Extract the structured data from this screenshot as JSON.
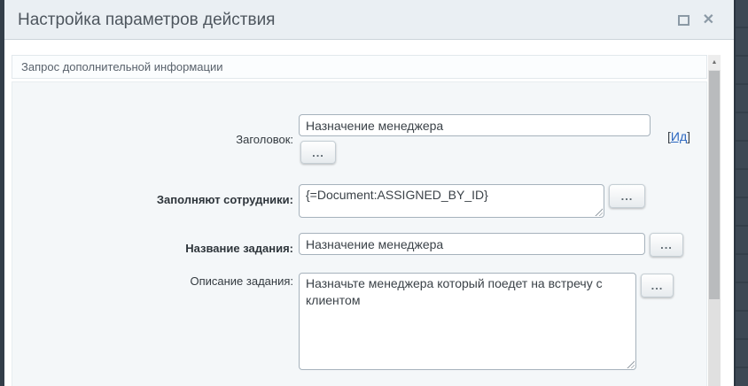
{
  "window": {
    "title": "Настройка параметров действия",
    "close_glyph": "✕"
  },
  "section": {
    "header": "Запрос дополнительной информации"
  },
  "form": {
    "header_field": {
      "label": "Заголовок:",
      "value": "Назначение менеджера",
      "button": "...",
      "id_link_open": "[",
      "id_link_text": "Ид",
      "id_link_close": "]"
    },
    "assignees_field": {
      "label": "Заполняют сотрудники:",
      "value": "{=Document:ASSIGNED_BY_ID}",
      "button": "..."
    },
    "task_name_field": {
      "label": "Название задания:",
      "value": "Назначение менеджера",
      "button": "..."
    },
    "task_description_field": {
      "label": "Описание задания:",
      "value": "Назначьте менеджера который поедет на встречу с клиентом",
      "button": "..."
    }
  },
  "scrollbar": {
    "up_glyph": "▲"
  },
  "colors": {
    "link_blue": "#2a66c0",
    "titlebar_bg": "#eaeff3",
    "panel_bg": "#f4f7f9",
    "page_bg": "#3d4854",
    "input_border": "#a6b2bc"
  }
}
